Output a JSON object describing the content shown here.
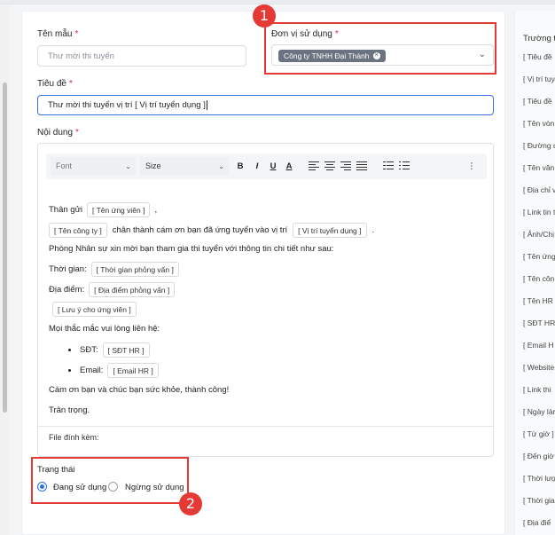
{
  "form": {
    "template_name_label": "Tên mẫu",
    "template_name_placeholder": "Thư mời thi tuyển",
    "unit_label": "Đơn vị sử dụng",
    "unit_selected": "Công ty TNHH Đại Thành",
    "title_label": "Tiêu đề",
    "title_value": "Thư mời thi tuyển vị trí  [ Vị trí tuyển dụng ]",
    "content_label": "Nội dung",
    "required_mark": "*"
  },
  "toolbar": {
    "font": "Font",
    "size": "Size",
    "bold": "B",
    "italic": "I",
    "underline": "U",
    "color": "A"
  },
  "editor": {
    "greeting": "Thân gửi",
    "tag_candidate": "[ Tên ứng viên ]",
    "comma": ",",
    "tag_company": "[ Tên công ty ]",
    "thanks_text": "chân thành cám ơn bạn đã ứng tuyển vào vị trí",
    "tag_position": "[ Vị trí tuyển dụng ]",
    "period": ".",
    "invite_text": "Phòng Nhân sự xin mời bạn tham gia thi tuyển với thông tin chi tiết như sau:",
    "time_label": "Thời gian:",
    "tag_time": "[ Thời gian phỏng vấn ]",
    "place_label": "Địa điểm:",
    "tag_place": "[ Địa điểm phỏng vấn ]",
    "tag_note": "[ Lưu ý cho ứng viên ]",
    "contact_text": "Mọi thắc mắc vui lòng liên hệ:",
    "phone_label": "SĐT:",
    "tag_phone": "[ SĐT HR ]",
    "email_label": "Email:",
    "tag_email": "[ Email HR ]",
    "closing": "Cám ơn bạn và chúc bạn sức khỏe, thành công!",
    "regards": "Trân trọng.",
    "attachment_label": "File đính kèm:"
  },
  "status": {
    "label": "Trạng thái",
    "options": [
      "Đang sử dụng",
      "Ngừng sử dụng"
    ],
    "selected": "Đang sử dụng"
  },
  "right_panel": {
    "title": "Trường t",
    "items": [
      "[ Tiêu đề",
      "[ Vị trí tuy",
      "[ Tiêu đề",
      "[ Tên vòn",
      "[ Đường d",
      "[ Tên văn",
      "[ Địa chỉ v",
      "[ Link tin t",
      "[ Ảnh/Chị",
      "[ Tên ứng",
      "[ Tên côn",
      "[ Tên HR",
      "[ SĐT HR",
      "[ Email H",
      "[ Website",
      "[ Link thi",
      "[ Ngày làm",
      "[ Từ giờ ]",
      "[ Đến giờ",
      "[ Thời lượ",
      "[ Thời gia",
      "[ Địa điể"
    ]
  },
  "annotations": {
    "badge_1": "1",
    "badge_2": "2",
    "highlight_color": "#e53935"
  },
  "colors": {
    "accent": "#3b6fe0",
    "tag_bg": "#6b7280",
    "required": "#e0245e"
  }
}
